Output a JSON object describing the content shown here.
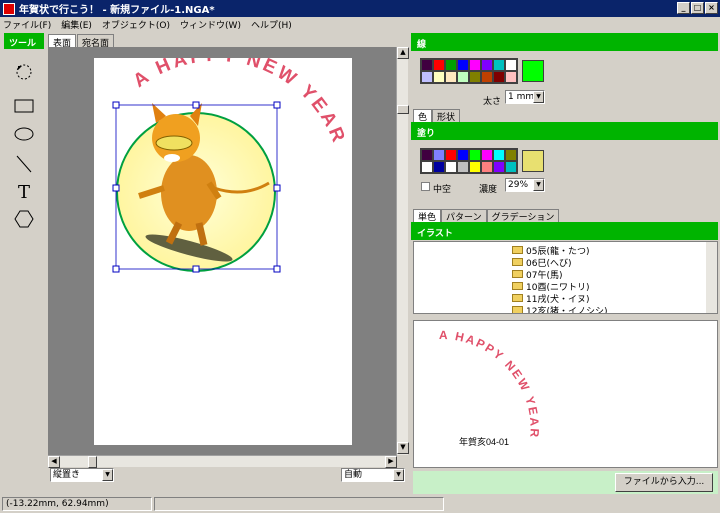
{
  "window": {
    "title": "年賀状で行こう！ - 新規ファイル-1.NGA*",
    "min": "_",
    "max": "□",
    "close": "×"
  },
  "menu": [
    "ファイル(F)",
    "編集(E)",
    "オブジェクト(O)",
    "ウィンドウ(W)",
    "ヘルプ(H)"
  ],
  "tools": {
    "title": "ツール",
    "text_tool": "T"
  },
  "doc_tabs": [
    "表面",
    "宛名面"
  ],
  "canvas": {
    "arc_text": "A HAPPY NEW YEAR",
    "arc_color": "#e0506a",
    "circle_fill": "#ffffb0",
    "circle_stroke": "#00a040"
  },
  "bottom_left": {
    "layout_select": "縦置き",
    "zoom_select": "自動"
  },
  "line_panel": {
    "title": "線",
    "palette": [
      "#400040",
      "#ff0000",
      "#00a000",
      "#0000ff",
      "#ff00ff",
      "#8000ff",
      "#00c0c0",
      "#ffffff",
      "#c0c0ff",
      "#ffffc0",
      "#ffe8c0",
      "#c0ffc0",
      "#808000",
      "#c04000",
      "#800000",
      "#ffc0c0"
    ],
    "current_color": "#00ff00",
    "width_label": "太さ",
    "width_value": "1 mm",
    "tabs": [
      "色",
      "形状"
    ]
  },
  "fill_panel": {
    "title": "塗り",
    "palette": [
      "#400040",
      "#8080ff",
      "#ff0000",
      "#0000ff",
      "#00ff00",
      "#ff00ff",
      "#00ffff",
      "#808000",
      "#ffffff",
      "#0000a0",
      "#ffffff",
      "#c0c0c0",
      "#ffff00",
      "#ff8080",
      "#8000ff",
      "#00c0c0"
    ],
    "current_color": "#e8e070",
    "hollow_label": "中空",
    "density_label": "濃度",
    "density_value": "29%",
    "tabs": [
      "単色",
      "パターン",
      "グラデーション"
    ]
  },
  "illust_panel": {
    "title": "イラスト",
    "items": [
      "05辰(龍・たつ)",
      "06巳(へび)",
      "07午(馬)",
      "10酉(ニワトリ)",
      "11戌(犬・イヌ)",
      "12亥(猪・イノシシ)"
    ],
    "preview_text": "A HAPPY NEW YEAR",
    "preview_caption": "年賀亥04-01",
    "import_button": "ファイルから入力..."
  },
  "status": {
    "coords": "(-13.22mm, 62.94mm)"
  }
}
